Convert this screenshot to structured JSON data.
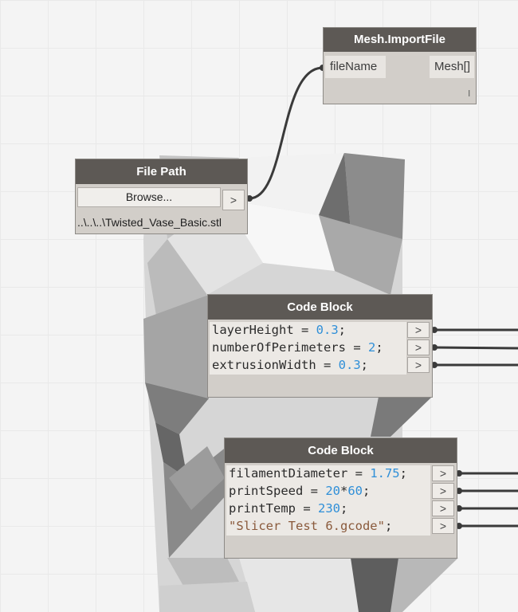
{
  "nodes": {
    "mesh_import": {
      "title": "Mesh.ImportFile",
      "input_port": "fileName",
      "output_port": "Mesh[]",
      "lacing_marker": "l"
    },
    "file_path": {
      "title": "File Path",
      "browse_label": "Browse...",
      "output_arrow": ">",
      "path_value": "..\\..\\..\\Twisted_Vase_Basic.stl"
    },
    "code_block_1": {
      "title": "Code Block",
      "lines": [
        {
          "name": "layerHeight",
          "op": " = ",
          "value": "0.3",
          "end": ";"
        },
        {
          "name": "numberOfPerimeters",
          "op": " = ",
          "value": "2",
          "end": ";"
        },
        {
          "name": "extrusionWidth",
          "op": " = ",
          "value": "0.3",
          "end": ";"
        }
      ],
      "output_arrow": ">"
    },
    "code_block_2": {
      "title": "Code Block",
      "line1": {
        "name": "filamentDiameter",
        "op": " = ",
        "value": "1.75",
        "end": ";"
      },
      "line2": {
        "name": "printSpeed",
        "op": " = ",
        "a": "20",
        "mul": "*",
        "b": "60",
        "end": ";"
      },
      "line3": {
        "name": "printTemp",
        "op": " = ",
        "value": "230",
        "end": ";"
      },
      "line4": {
        "value": "\"Slicer Test 6.gcode\"",
        "end": ";"
      },
      "output_arrow": ">"
    }
  },
  "colors": {
    "node_header": "#5d5955",
    "node_body": "#d2cec9",
    "number": "#2f8fd8",
    "string": "#8a5a3c",
    "wire": "#3a3a3a"
  }
}
